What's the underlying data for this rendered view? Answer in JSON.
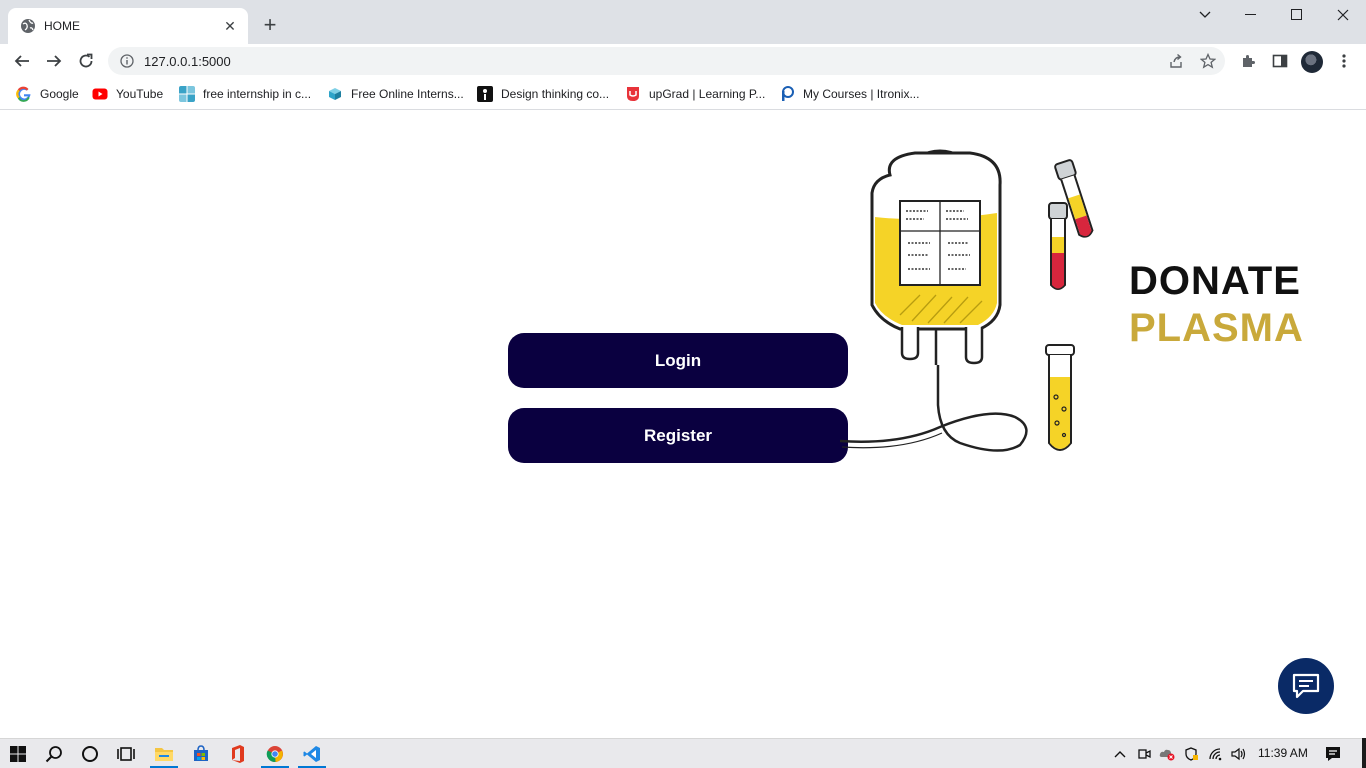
{
  "browser": {
    "tab_title": "HOME",
    "close_glyph": "✕",
    "new_tab_glyph": "+",
    "url": "127.0.0.1:5000",
    "window_controls": [
      "chevron-down-icon",
      "minimize-icon",
      "maximize-icon",
      "close-icon"
    ]
  },
  "bookmarks": [
    {
      "label": "Google",
      "icon": "google-icon",
      "color": "#4285f4"
    },
    {
      "label": "YouTube",
      "icon": "youtube-icon",
      "color": "#ff0000"
    },
    {
      "label": "free internship in c...",
      "icon": "internship-icon",
      "color": "#3aa3c7"
    },
    {
      "label": "Free Online Interns...",
      "icon": "box-icon",
      "color": "#2fa4c9"
    },
    {
      "label": "Design thinking co...",
      "icon": "design-icon",
      "color": "#111111"
    },
    {
      "label": "upGrad | Learning P...",
      "icon": "upgrad-icon",
      "color": "#e8333a"
    },
    {
      "label": "My Courses | Itronix...",
      "icon": "itronix-icon",
      "color": "#1a5fb4"
    }
  ],
  "page": {
    "login_label": "Login",
    "register_label": "Register",
    "brand_line1": "DONATE",
    "brand_line2": "PLASMA",
    "colors": {
      "button": "#0a0040",
      "plasma": "#c9a93b",
      "bag_fill": "#f5d327",
      "blood": "#d7263d",
      "fab": "#0a2a66"
    }
  },
  "taskbar": {
    "apps": [
      "windows-start-icon",
      "search-icon",
      "cortana-icon",
      "task-view-icon",
      "file-explorer-icon",
      "store-icon",
      "office-icon",
      "chrome-icon",
      "vscode-icon"
    ],
    "time": "11:39 AM"
  }
}
